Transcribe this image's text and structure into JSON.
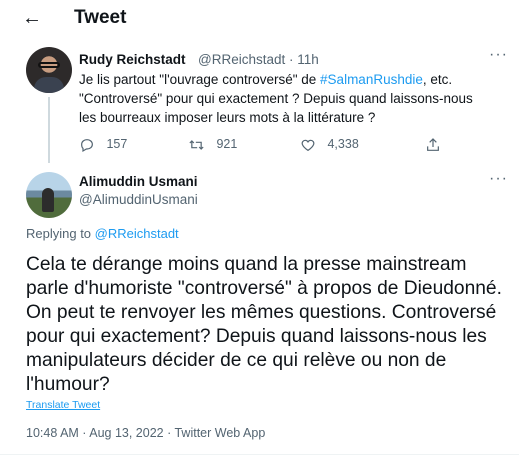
{
  "header": {
    "back_icon": "arrow-left-icon",
    "back_glyph": "←",
    "title": "Tweet"
  },
  "parent_tweet": {
    "author_name": "Rudy Reichstadt",
    "author_handle": "@RReichstadt · 11h",
    "text_part1": "Je lis partout \"l'ouvrage controversé\" de ",
    "hashtag": "#SalmanRushdie",
    "text_part2": ", etc. \"Controversé\" pour qui exactement ? Depuis quand laissons-nous les bourreaux imposer leurs mots à la littérature ?",
    "more": "···",
    "actions": {
      "reply_count": "157",
      "retweet_count": "921",
      "like_count": "4,338"
    }
  },
  "reply_tweet": {
    "author_name": "Alimuddin Usmani",
    "author_handle": "@AlimuddinUsmani",
    "more": "···",
    "replying_prefix": "Replying to ",
    "replying_handle": "@RReichstadt",
    "text": "Cela te dérange moins quand la presse mainstream parle d'humoriste \"controversé\" à propos de Dieudonné. On peut te renvoyer les mêmes questions. Controversé pour qui exactement? Depuis quand laissons-nous les manipulateurs décider de ce qui relève ou non de l'humour?",
    "translate_label": "Translate Tweet",
    "timestamp": "10:48 AM · Aug 13, 2022 · Twitter Web App"
  },
  "colors": {
    "accent": "#1d9bf0",
    "secondary_text": "#536471",
    "primary_text": "#0f1419"
  }
}
